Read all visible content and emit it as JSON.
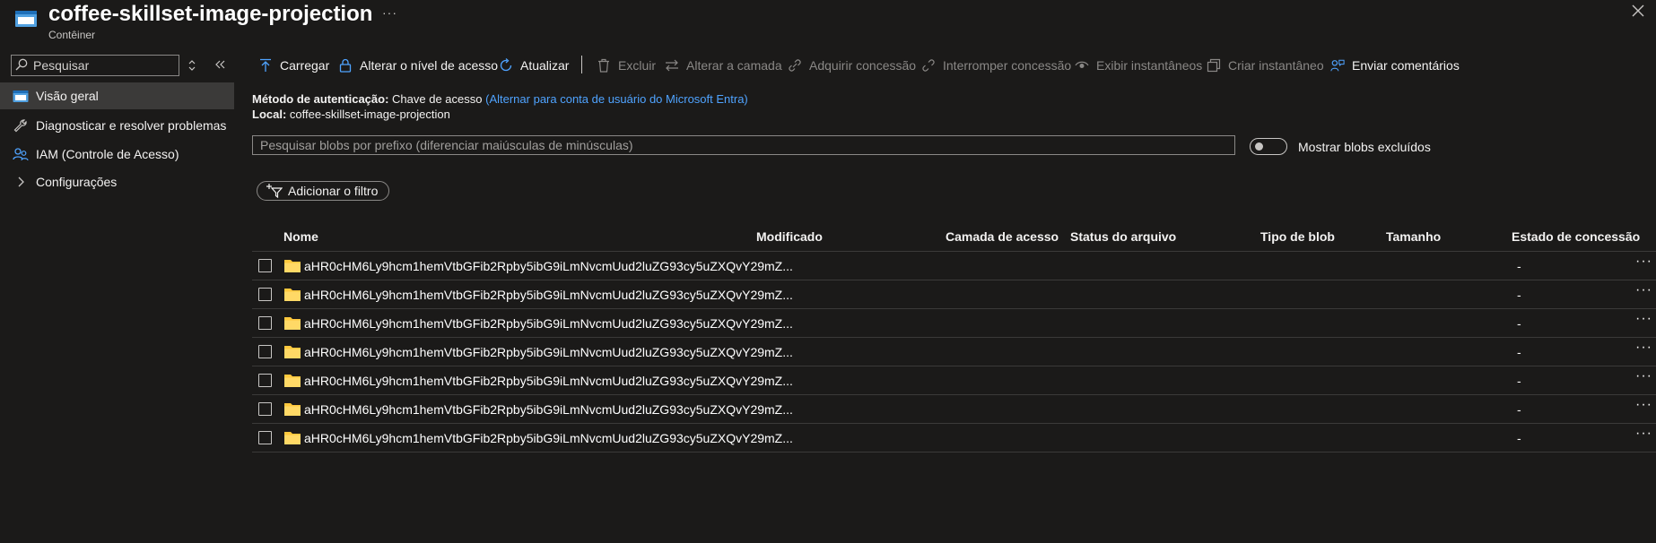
{
  "header": {
    "title": "coffee-skillset-image-projection",
    "subtitle": "Contêiner",
    "more": "···"
  },
  "sidebar": {
    "search_placeholder": "Pesquisar",
    "items": [
      {
        "label": "Visão geral",
        "icon": "container-icon",
        "active": true
      },
      {
        "label": "Diagnosticar e resolver problemas",
        "icon": "wrench-icon",
        "active": false
      },
      {
        "label": "IAM (Controle de Acesso)",
        "icon": "people-icon",
        "active": false
      },
      {
        "label": "Configurações",
        "icon": "chevron-right-icon",
        "active": false
      }
    ]
  },
  "toolbar": {
    "upload": "Carregar",
    "change_access": "Alterar o nível de acesso",
    "refresh": "Atualizar",
    "delete": "Excluir",
    "change_tier": "Alterar a camada",
    "acquire_lease": "Adquirir concessão",
    "break_lease": "Interromper concessão",
    "view_snapshots": "Exibir instantâneos",
    "create_snapshot": "Criar instantâneo",
    "feedback": "Enviar comentários"
  },
  "info": {
    "auth_label": "Método de autenticação:",
    "auth_value": "Chave de acesso",
    "auth_link": "(Alternar para conta de usuário do Microsoft Entra)",
    "location_label": "Local:",
    "location_value": "coffee-skillset-image-projection"
  },
  "blob_search": {
    "placeholder": "Pesquisar blobs por prefixo (diferenciar maiúsculas de minúsculas)"
  },
  "show_deleted": {
    "label": "Mostrar blobs excluídos",
    "on": false
  },
  "filter": {
    "label": "Adicionar o filtro"
  },
  "table": {
    "columns": [
      "Nome",
      "Modificado",
      "Camada de acesso",
      "Status do arquivo",
      "Tipo de blob",
      "Tamanho",
      "Estado de concessão"
    ],
    "rows": [
      {
        "name": "aHR0cHM6Ly9hcm1hemVtbGFib2Rpby5ibG9iLmNvcmUud2luZG93cy5uZXQvY29mZ...",
        "lease": "-"
      },
      {
        "name": "aHR0cHM6Ly9hcm1hemVtbGFib2Rpby5ibG9iLmNvcmUud2luZG93cy5uZXQvY29mZ...",
        "lease": "-"
      },
      {
        "name": "aHR0cHM6Ly9hcm1hemVtbGFib2Rpby5ibG9iLmNvcmUud2luZG93cy5uZXQvY29mZ...",
        "lease": "-"
      },
      {
        "name": "aHR0cHM6Ly9hcm1hemVtbGFib2Rpby5ibG9iLmNvcmUud2luZG93cy5uZXQvY29mZ...",
        "lease": "-"
      },
      {
        "name": "aHR0cHM6Ly9hcm1hemVtbGFib2Rpby5ibG9iLmNvcmUud2luZG93cy5uZXQvY29mZ...",
        "lease": "-"
      },
      {
        "name": "aHR0cHM6Ly9hcm1hemVtbGFib2Rpby5ibG9iLmNvcmUud2luZG93cy5uZXQvY29mZ...",
        "lease": "-"
      },
      {
        "name": "aHR0cHM6Ly9hcm1hemVtbGFib2Rpby5ibG9iLmNvcmUud2luZG93cy5uZXQvY29mZ...",
        "lease": "-"
      }
    ],
    "row_menu": "···"
  },
  "colors": {
    "background": "#1b1a19",
    "accent": "#4fa3ff",
    "folder": "#ffc83d",
    "active_nav": "#3b3a39"
  }
}
